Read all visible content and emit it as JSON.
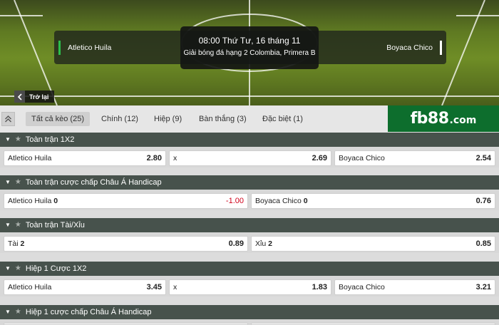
{
  "match": {
    "home_team": "Atletico Huila",
    "away_team": "Boyaca Chico",
    "datetime": "08:00 Thứ Tư, 16 tháng 11",
    "league": "Giải bóng đá hạng 2 Colombia, Primera B"
  },
  "back_label": "Trở lại",
  "tabs": [
    {
      "label": "Tất cả kèo (25)",
      "active": true
    },
    {
      "label": "Chính (12)"
    },
    {
      "label": "Hiệp (9)"
    },
    {
      "label": "Bàn thắng (3)"
    },
    {
      "label": "Đặc biệt (1)"
    }
  ],
  "brand": {
    "name": "fb88",
    "suffix": ".com",
    "color": "#0d6e2d"
  },
  "sections": [
    {
      "title": "Toàn trận 1X2",
      "cells": [
        {
          "label": "Atletico Huila",
          "odd": "2.80"
        },
        {
          "label": "x",
          "odd": "2.69"
        },
        {
          "label": "Boyaca Chico",
          "odd": "2.54"
        }
      ]
    },
    {
      "title": "Toàn trận cược chấp Châu Á Handicap",
      "cells": [
        {
          "label": "Atletico Huila",
          "line": "0",
          "odd": "-1.00"
        },
        {
          "label": "Boyaca Chico",
          "line": "0",
          "odd": "0.76"
        }
      ]
    },
    {
      "title": "Toàn trận Tài/Xỉu",
      "cells": [
        {
          "label": "Tài",
          "line": "2",
          "odd": "0.89"
        },
        {
          "label": "Xỉu",
          "line": "2",
          "odd": "0.85"
        }
      ]
    },
    {
      "title": "Hiệp 1 Cược 1X2",
      "cells": [
        {
          "label": "Atletico Huila",
          "odd": "3.45"
        },
        {
          "label": "x",
          "odd": "1.83"
        },
        {
          "label": "Boyaca Chico",
          "odd": "3.21"
        }
      ]
    },
    {
      "title": "Hiệp 1 cược chấp Châu Á Handicap",
      "cells": []
    }
  ],
  "colors": {
    "section_header": "#47524c",
    "negative_odd": "#d0021b",
    "home_marker": "#2bbf4b"
  }
}
